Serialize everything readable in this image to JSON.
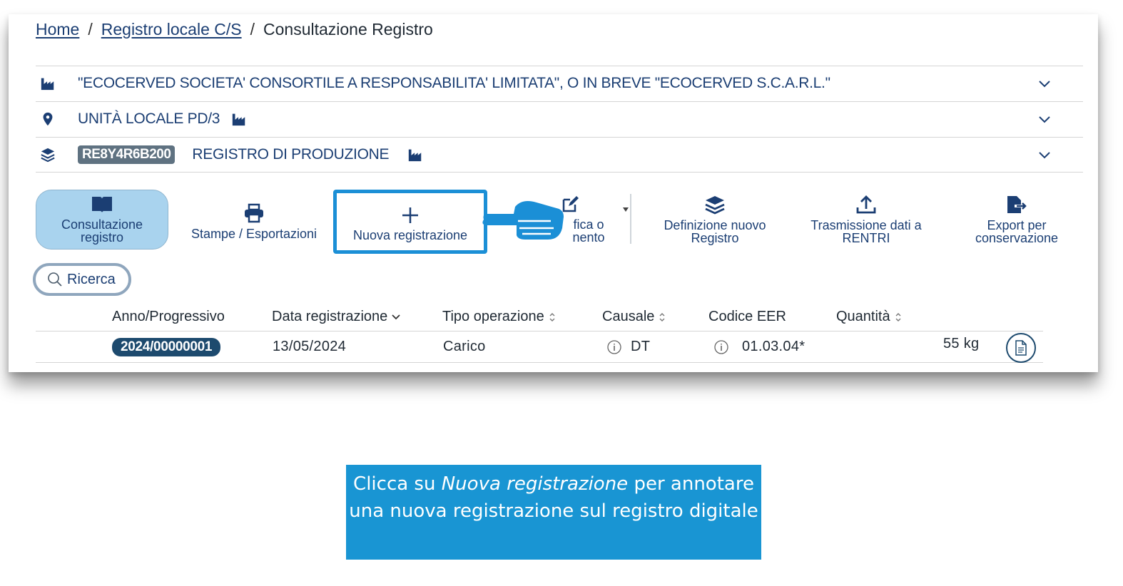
{
  "breadcrumb": {
    "home": "Home",
    "registro": "Registro locale C/S",
    "current": "Consultazione Registro",
    "separator": "/"
  },
  "accordion": {
    "company": "\"ECOCERVED SOCIETA' CONSORTILE A RESPONSABILITA' LIMITATA\", O IN BREVE \"ECOCERVED S.C.A.R.L.\"",
    "unit": "UNITÀ LOCALE PD/3",
    "register_code": "RE8Y4R6B200",
    "register_name": "REGISTRO DI PRODUZIONE"
  },
  "toolbar": {
    "consultazione_line1": "Consultazione",
    "consultazione_line2": "registro",
    "stampe": "Stampe / Esportazioni",
    "nuova": "Nuova registrazione",
    "modifica_line1": "fica o",
    "modifica_line2": "nento",
    "definizione_line1": "Definizione nuovo",
    "definizione_line2": "Registro",
    "trasmissione_line1": "Trasmissione dati a",
    "trasmissione_line2": "RENTRI",
    "export_line1": "Export per",
    "export_line2": "conservazione"
  },
  "search": {
    "label": "Ricerca"
  },
  "table": {
    "headers": [
      "Anno/Progressivo",
      "Data registrazione",
      "Tipo operazione",
      "Causale",
      "Codice EER",
      "Quantità"
    ],
    "rows": [
      {
        "progressivo": "2024/00000001",
        "data": "13/05/2024",
        "tipo": "Carico",
        "causale": "DT",
        "eer": "01.03.04*",
        "quantita": "55 kg"
      }
    ]
  },
  "callout": {
    "before": "Clicca su ",
    "emphasis": "Nuova registrazione",
    "after": " per annotare una nuova registrazione sul registro digitale"
  },
  "colors": {
    "primary": "#1b3e73",
    "accent": "#1b8fd6",
    "active_bg": "#a9d3ee",
    "callout_bg": "#1995d3",
    "badge_dark": "#1d4a6e"
  }
}
